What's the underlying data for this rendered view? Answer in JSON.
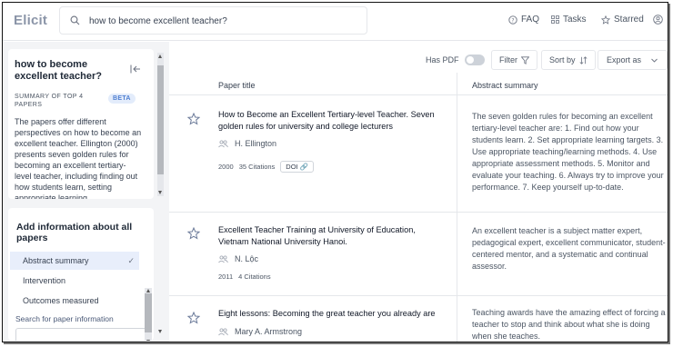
{
  "app": {
    "logo": "Elicit"
  },
  "search": {
    "value": "how to become excellent teacher?"
  },
  "nav": {
    "faq": "FAQ",
    "tasks": "Tasks",
    "starred": "Starred"
  },
  "sidebar": {
    "question": "how to become excellent teacher?",
    "summary_label": "SUMMARY OF TOP 4 PAPERS",
    "beta": "BETA",
    "summary_text": "The papers offer different perspectives on how to become an excellent teacher. Ellington (2000) presents seven golden rules for becoming an excellent tertiary-level teacher, including finding out how students learn, setting appropriate learning",
    "add_title": "Add information about all papers",
    "options": [
      {
        "label": "Abstract summary",
        "selected": true
      },
      {
        "label": "Intervention",
        "selected": false
      },
      {
        "label": "Outcomes measured",
        "selected": false
      }
    ],
    "search_info_label": "Search for paper information"
  },
  "toolbar": {
    "has_pdf": "Has PDF",
    "filter": "Filter",
    "sort_by": "Sort by",
    "export_as": "Export as"
  },
  "table": {
    "col_title": "Paper title",
    "col_abstract": "Abstract summary",
    "rows": [
      {
        "title": "How to Become an Excellent Tertiary-level Teacher. Seven golden rules for university and college lecturers",
        "authors": "H. Ellington",
        "year": "2000",
        "citations": "35 Citations",
        "doi": "DOI",
        "abstract": "The seven golden rules for becoming an excellent tertiary-level teacher are: 1. Find out how your students learn. 2. Set appropriate learning targets. 3. Use appropriate teaching/learning methods. 4. Use appropriate assessment methods. 5. Monitor and evaluate your teaching. 6. Always try to improve your performance. 7. Keep yourself up-to-date."
      },
      {
        "title": "Excellent Teacher Training at University of Education, Vietnam National University Hanoi.",
        "authors": "N. Lộc",
        "year": "2011",
        "citations": "4 Citations",
        "abstract": "An excellent teacher is a subject matter expert, pedagogical expert, excellent communicator, student-centered mentor, and a systematic and continual assessor."
      },
      {
        "title": "Eight lessons: Becoming the great teacher you already are",
        "authors": "Mary A. Armstrong",
        "abstract": "Teaching awards have the amazing effect of forcing a teacher to stop and think about what she is doing when she teaches."
      }
    ]
  },
  "colors": {
    "accent": "#4f7fd1",
    "selected_bg": "#e8eefb",
    "sidebar_bg": "#f3f4f6"
  }
}
